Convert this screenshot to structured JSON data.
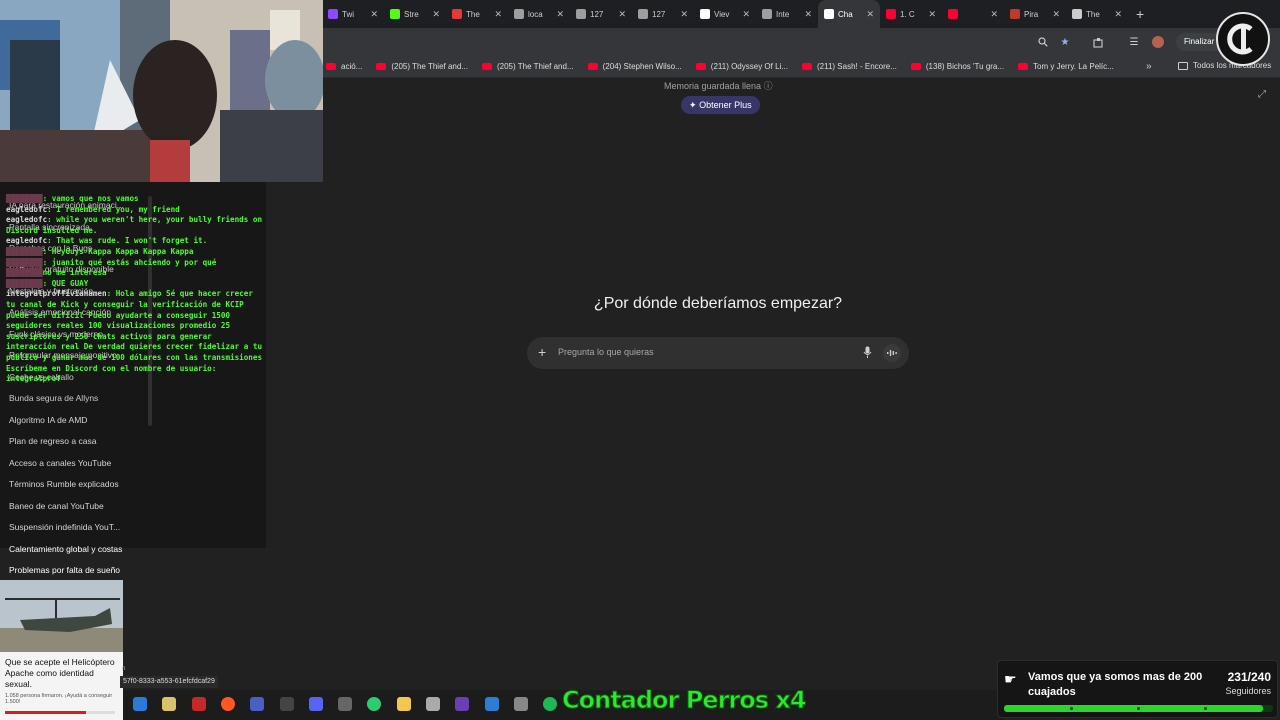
{
  "tabs": [
    {
      "label": "Twi",
      "icon": "twitch-icon",
      "color": "#9146ff"
    },
    {
      "label": "Stre",
      "icon": "kick-icon",
      "color": "#53fc18"
    },
    {
      "label": "The",
      "icon": "game-icon",
      "color": "#e53935"
    },
    {
      "label": "loca",
      "icon": "globe-icon",
      "color": "#9e9e9e"
    },
    {
      "label": "127",
      "icon": "globe-icon",
      "color": "#9e9e9e"
    },
    {
      "label": "127",
      "icon": "globe-icon",
      "color": "#9e9e9e"
    },
    {
      "label": "Viev",
      "icon": "github-icon",
      "color": "#ffffff"
    },
    {
      "label": "Inte",
      "icon": "globe-icon",
      "color": "#9e9e9e"
    },
    {
      "label": "Cha",
      "icon": "chatgpt-icon",
      "color": "#ffffff",
      "active": true
    },
    {
      "label": "1. C",
      "icon": "youtube-icon",
      "color": "#ff0033"
    },
    {
      "label": "",
      "icon": "youtube-icon",
      "color": "#ff0033"
    },
    {
      "label": "Pira",
      "icon": "document-icon",
      "color": "#c0392b"
    },
    {
      "label": "The",
      "icon": "document-icon",
      "color": "#cccccc"
    }
  ],
  "toolbar": {
    "finalize_label": "Finalizar a"
  },
  "bookmarks": [
    {
      "label": "ació..."
    },
    {
      "label": "(205) The Thief and..."
    },
    {
      "label": "(205) The Thief and..."
    },
    {
      "label": "(204) Stephen Wilso..."
    },
    {
      "label": "(211) Odyssey Of Li..."
    },
    {
      "label": "(211) Sash! - Encore..."
    },
    {
      "label": "(138) Bichos 'Tu gra..."
    },
    {
      "label": "Tom y Jerry. La Pelíc..."
    }
  ],
  "bookmarks_all": "Todos los marcadores",
  "app": {
    "memory_notice": "Memoria guardada llena",
    "plus_button": "Obtener Plus",
    "headline": "¿Por dónde deberíamos empezar?",
    "composer_placeholder": "Pregunta lo que quieras"
  },
  "history": [
    "IA para restauración animaci...",
    "Pantalla sincronizada",
    "Derechos con la Bugs",
    "Software gratuito disponible",
    "Nostalgia y frustración",
    "Análisis emocional canción",
    "Funk clásico vs moderno",
    "Reformular mensaje positivo",
    "Coche vs caballo",
    "Bunda segura de Allyns",
    "Algoritmo IA de AMD",
    "Plan de regreso a casa",
    "Acceso a canales YouTube",
    "Términos Rumble explicados",
    "Baneo de canal YouTube",
    "Suspensión indefinida YouT...",
    "Calentamiento global y costas",
    "Problemas por falta de sueño"
  ],
  "chat": [
    {
      "user": "",
      "text": ": vamos que nos vamos",
      "dim": true
    },
    {
      "user": "eagledofc",
      "text": ": I remembered you, my friend"
    },
    {
      "user": "eagledofc",
      "text": ": while you weren't here, your bully friends on Discord insulted me."
    },
    {
      "user": "eagledofc",
      "text": ": That was rude. I won't forget it."
    },
    {
      "user": "",
      "text": ": HeyGuys Kappa Kappa Kappa Kappa",
      "dim": true
    },
    {
      "user": "",
      "text": ": juanito qué estás ahciendo y por qué",
      "dim": true
    },
    {
      "user": "",
      "text": "no me interesa",
      "dim": true
    },
    {
      "user": "",
      "text": ": QUE GUAY",
      "dim": true
    },
    {
      "user": "integralproffivianamen",
      "text": ": Hola amigo Sé que hacer crecer tu canal de Kick y conseguir la verificación de KCIP puede ser difícil Puedo ayudarte a conseguir 1500 seguidores reales 100 visualizaciones promedio 25 suscriptores y 250 chats activos para generar interacción real De verdad quieres crecer fidelizar a tu público y ganar más de 100 dólares con las transmisiones Escríbeme en Discord con el nombre de usuario: integralprof"
    }
  ],
  "news": {
    "title": "Que se acepte el Helicóptero Apache como identidad sexual.",
    "meta": "1.058 persona firmaron. ¡Ayudá a conseguir 1.500!",
    "progress": 0.74
  },
  "url_hint": "57f0-8333-a553-61efcfdcaf29",
  "url_hint_prefix": "n",
  "counter_text": "Contador Perros x4",
  "goal": {
    "title": "Vamos que ya somos mas de 200 cuajados",
    "count": "231/240",
    "label": "Seguidores",
    "progress": 0.9625
  },
  "colors": {
    "accent_green": "#2ee82e",
    "plus_button_bg": "#373669",
    "chat_text": "#4cff2e"
  }
}
